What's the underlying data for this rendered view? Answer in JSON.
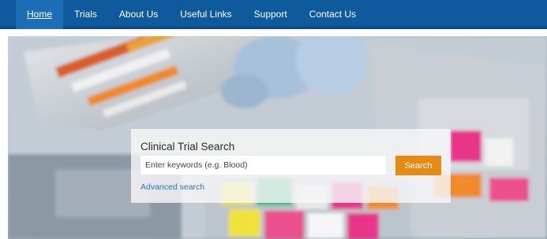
{
  "nav": {
    "items": [
      {
        "label": "Home",
        "active": true
      },
      {
        "label": "Trials",
        "active": false
      },
      {
        "label": "About Us",
        "active": false
      },
      {
        "label": "Useful Links",
        "active": false
      },
      {
        "label": "Support",
        "active": false
      },
      {
        "label": "Contact Us",
        "active": false
      }
    ]
  },
  "search": {
    "title": "Clinical Trial Search",
    "placeholder": "Enter keywords (e.g. Blood)",
    "value": "",
    "button_label": "Search",
    "advanced_link": "Advanced search"
  },
  "colors": {
    "nav_background": "#0f5a9c",
    "nav_active": "#1b6db6",
    "search_button": "#e58a12",
    "link": "#2f74b8"
  }
}
